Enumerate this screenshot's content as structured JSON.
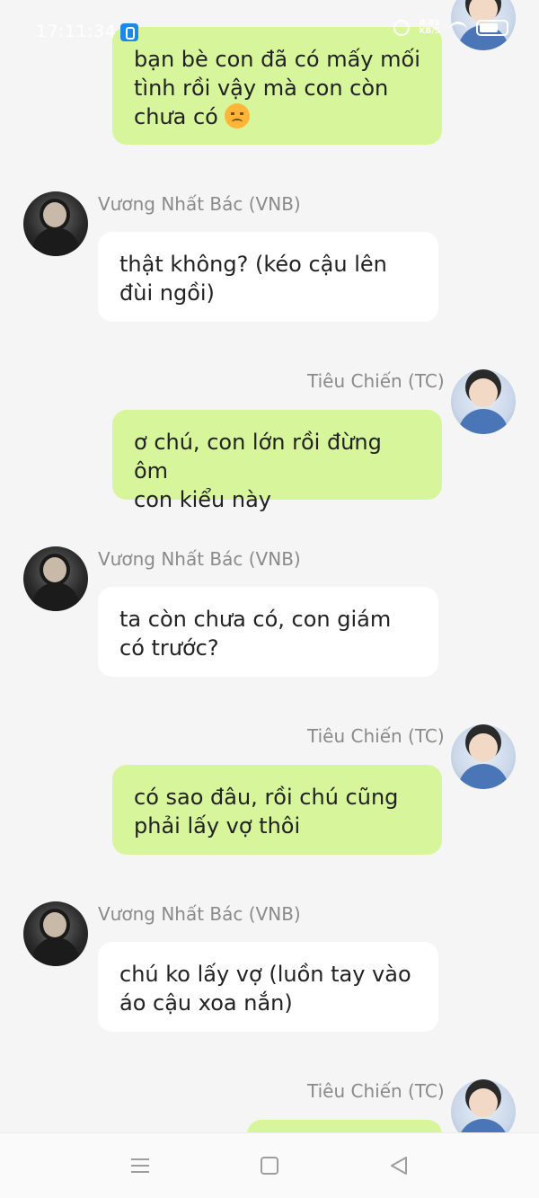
{
  "status_bar": {
    "time": "17:11:34",
    "net_speed_value": "0.03",
    "net_speed_unit": "KB/S"
  },
  "messages": [
    {
      "sender": "Tiêu Chiến (TC)",
      "side": "out",
      "text_line1": "bạn bè con đã có mấy mối",
      "text_line2": "tình rồi vậy mà con còn",
      "text_line3": "chưa có"
    },
    {
      "sender": "Vương Nhất Bác (VNB)",
      "side": "in",
      "text_line1": "thật không? (kéo cậu lên",
      "text_line2": "đùi ngồi)"
    },
    {
      "sender": "Tiêu Chiến (TC)",
      "side": "out",
      "text_line1": "ơ chú, con lớn rồi đừng ôm",
      "text_line2": "con kiểu này"
    },
    {
      "sender": "Vương Nhất Bác (VNB)",
      "side": "in",
      "text_line1": "ta còn chưa có, con giám",
      "text_line2": "có trước?"
    },
    {
      "sender": "Tiêu Chiến (TC)",
      "side": "out",
      "text_line1": "có sao đâu, rồi chú cũng",
      "text_line2": "phải lấy vợ thôi"
    },
    {
      "sender": "Vương Nhất Bác (VNB)",
      "side": "in",
      "text_line1": "chú ko lấy vợ (luồn tay vào",
      "text_line2": "áo cậu xoa nắn)"
    },
    {
      "sender": "Tiêu Chiến (TC)",
      "side": "out"
    }
  ],
  "colors": {
    "incoming_bubble": "#ffffff",
    "outgoing_bubble": "#d7f59a",
    "sender_name": "#8a8a8a",
    "background": "#f5f5f5"
  },
  "icons": {
    "status_app": "app-notification-icon",
    "alarm": "alarm-icon",
    "wifi": "wifi-icon",
    "battery": "battery-icon",
    "emoji": "sad-face-emoji-icon",
    "nav_menu": "menu-icon",
    "nav_home": "home-icon",
    "nav_back": "back-icon"
  }
}
